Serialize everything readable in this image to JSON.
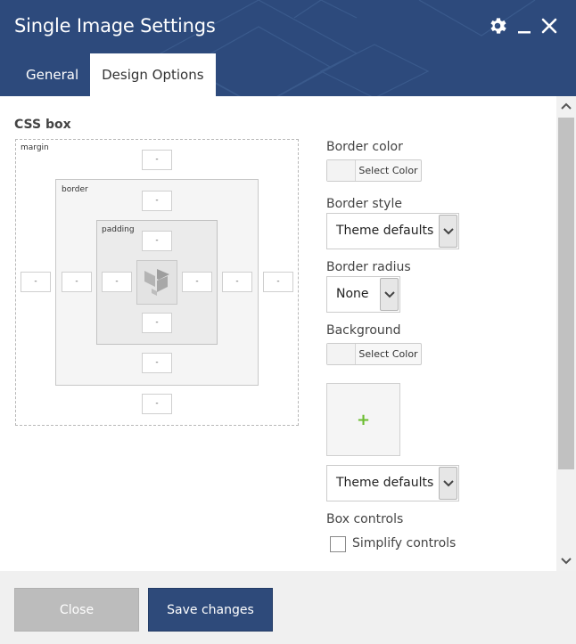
{
  "header": {
    "title": "Single Image Settings",
    "tabs": [
      {
        "label": "General"
      },
      {
        "label": "Design Options"
      }
    ],
    "colors": {
      "header_bg": "#2d4a7c",
      "accent_green": "#6bbd30"
    }
  },
  "css_box": {
    "label": "CSS box",
    "margin_label": "margin",
    "border_label": "border",
    "padding_label": "padding",
    "margin": {
      "top": "-",
      "right": "-",
      "bottom": "-",
      "left": "-"
    },
    "border": {
      "top": "-",
      "right": "-",
      "bottom": "-",
      "left": "-"
    },
    "padding": {
      "top": "-",
      "right": "-",
      "bottom": "-",
      "left": "-"
    }
  },
  "options": {
    "border_color_label": "Border color",
    "select_color": "Select Color",
    "border_style_label": "Border style",
    "border_style_value": "Theme defaults",
    "border_radius_label": "Border radius",
    "border_radius_value": "None",
    "background_label": "Background",
    "background_style_value": "Theme defaults",
    "box_controls_label": "Box controls",
    "simplify_label": "Simplify controls"
  },
  "footer": {
    "close": "Close",
    "save": "Save changes"
  }
}
